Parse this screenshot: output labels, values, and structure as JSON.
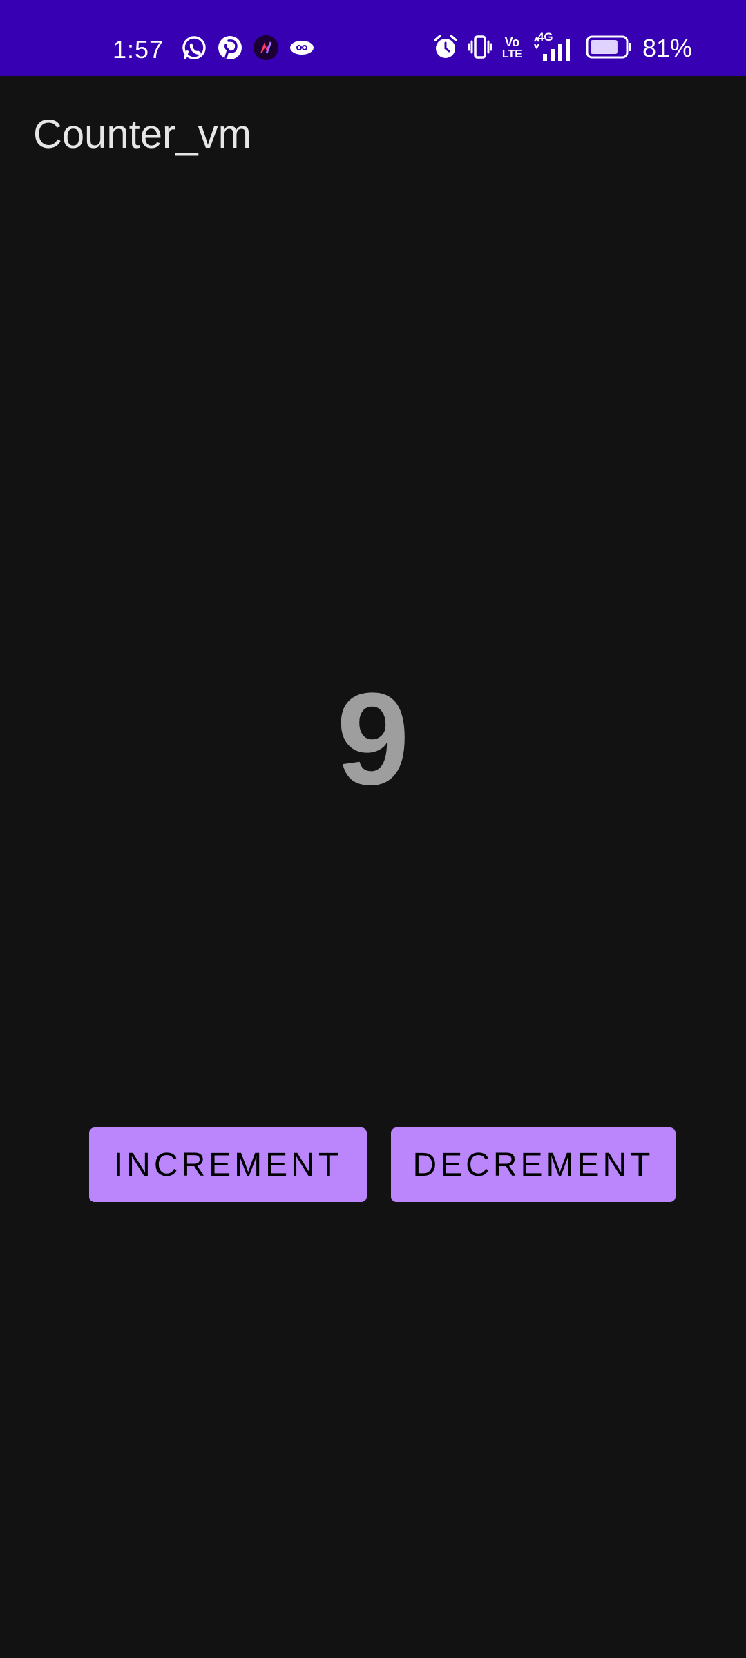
{
  "status_bar": {
    "time": "1:57",
    "battery_percent": "81%",
    "network_label": "4G",
    "volte_label_top": "Vo",
    "volte_label_bottom": "LTE",
    "battery_level": 0.81,
    "left_icons": [
      "whatsapp-icon",
      "pinterest-icon",
      "app-notification-icon",
      "vpn-eye-icon"
    ],
    "right_icons": [
      "alarm-icon",
      "vibrate-icon",
      "volte-icon",
      "signal-icon",
      "battery-icon"
    ],
    "background_color": "#3700B3"
  },
  "app": {
    "title": "Counter_vm",
    "background_color": "#121212"
  },
  "counter": {
    "value": "9",
    "color": "#9e9e9e"
  },
  "buttons": {
    "increment_label": "INCREMENT",
    "decrement_label": "DECREMENT",
    "color": "#BB86FC"
  }
}
